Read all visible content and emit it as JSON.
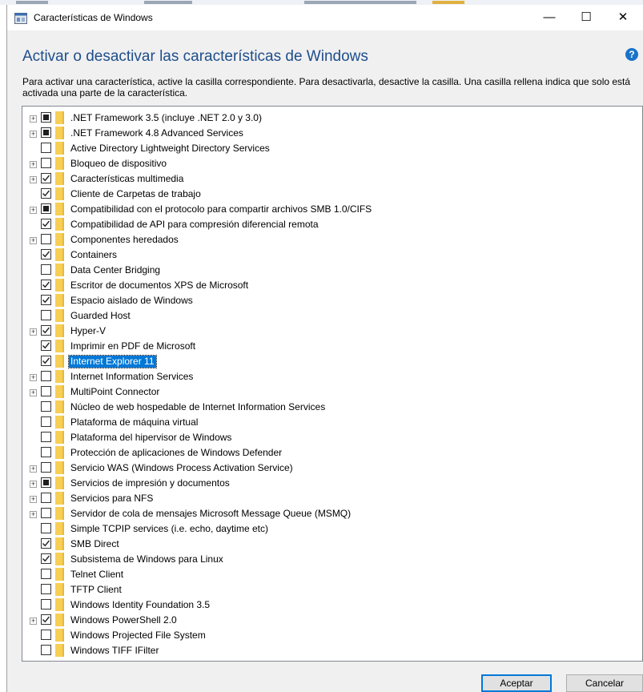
{
  "window": {
    "title": "Características de Windows",
    "heading": "Activar o desactivar las características de Windows",
    "description": "Para activar una característica, active la casilla correspondiente. Para desactivarla, desactive la casilla. Una casilla rellena indica que solo está activada una parte de la característica.",
    "controls": {
      "minimize": "—",
      "maximize": "☐",
      "close": "✕"
    },
    "help": "?"
  },
  "features": [
    {
      "label": ".NET Framework 3.5 (incluye .NET 2.0 y 3.0)",
      "state": "partial",
      "expandable": true
    },
    {
      "label": ".NET Framework 4.8 Advanced Services",
      "state": "partial",
      "expandable": true
    },
    {
      "label": "Active Directory Lightweight Directory Services",
      "state": "unchecked",
      "expandable": false
    },
    {
      "label": "Bloqueo de dispositivo",
      "state": "unchecked",
      "expandable": true
    },
    {
      "label": "Características multimedia",
      "state": "checked",
      "expandable": true
    },
    {
      "label": "Cliente de Carpetas de trabajo",
      "state": "checked",
      "expandable": false
    },
    {
      "label": "Compatibilidad con el protocolo para compartir archivos SMB 1.0/CIFS",
      "state": "partial",
      "expandable": true
    },
    {
      "label": "Compatibilidad de API para compresión diferencial remota",
      "state": "checked",
      "expandable": false
    },
    {
      "label": "Componentes heredados",
      "state": "unchecked",
      "expandable": true
    },
    {
      "label": "Containers",
      "state": "checked",
      "expandable": false
    },
    {
      "label": "Data Center Bridging",
      "state": "unchecked",
      "expandable": false
    },
    {
      "label": "Escritor de documentos XPS de Microsoft",
      "state": "checked",
      "expandable": false
    },
    {
      "label": "Espacio aislado de Windows",
      "state": "checked",
      "expandable": false
    },
    {
      "label": "Guarded Host",
      "state": "unchecked",
      "expandable": false
    },
    {
      "label": "Hyper-V",
      "state": "checked",
      "expandable": true
    },
    {
      "label": "Imprimir en PDF de Microsoft",
      "state": "checked",
      "expandable": false
    },
    {
      "label": "Internet Explorer 11",
      "state": "checked",
      "expandable": false,
      "selected": true
    },
    {
      "label": "Internet Information Services",
      "state": "unchecked",
      "expandable": true
    },
    {
      "label": "MultiPoint Connector",
      "state": "unchecked",
      "expandable": true
    },
    {
      "label": "Núcleo de web hospedable de Internet Information Services",
      "state": "unchecked",
      "expandable": false
    },
    {
      "label": "Plataforma de máquina virtual",
      "state": "unchecked",
      "expandable": false
    },
    {
      "label": "Plataforma del hipervisor de Windows",
      "state": "unchecked",
      "expandable": false
    },
    {
      "label": "Protección de aplicaciones de Windows Defender",
      "state": "unchecked",
      "expandable": false
    },
    {
      "label": "Servicio WAS (Windows Process Activation Service)",
      "state": "unchecked",
      "expandable": true
    },
    {
      "label": "Servicios de impresión y documentos",
      "state": "partial",
      "expandable": true
    },
    {
      "label": "Servicios para NFS",
      "state": "unchecked",
      "expandable": true
    },
    {
      "label": "Servidor de cola de mensajes Microsoft Message Queue (MSMQ)",
      "state": "unchecked",
      "expandable": true
    },
    {
      "label": "Simple TCPIP services (i.e. echo, daytime etc)",
      "state": "unchecked",
      "expandable": false
    },
    {
      "label": "SMB Direct",
      "state": "checked",
      "expandable": false
    },
    {
      "label": "Subsistema de Windows para Linux",
      "state": "checked",
      "expandable": false
    },
    {
      "label": "Telnet Client",
      "state": "unchecked",
      "expandable": false
    },
    {
      "label": "TFTP Client",
      "state": "unchecked",
      "expandable": false
    },
    {
      "label": "Windows Identity Foundation 3.5",
      "state": "unchecked",
      "expandable": false
    },
    {
      "label": "Windows PowerShell 2.0",
      "state": "checked",
      "expandable": true
    },
    {
      "label": "Windows Projected File System",
      "state": "unchecked",
      "expandable": false
    },
    {
      "label": "Windows TIFF IFilter",
      "state": "unchecked",
      "expandable": false
    }
  ],
  "buttons": {
    "ok": "Aceptar",
    "cancel": "Cancelar"
  },
  "colors": {
    "heading": "#1e4e8c",
    "selection": "#0078d7",
    "folder": "#f7cf55"
  }
}
